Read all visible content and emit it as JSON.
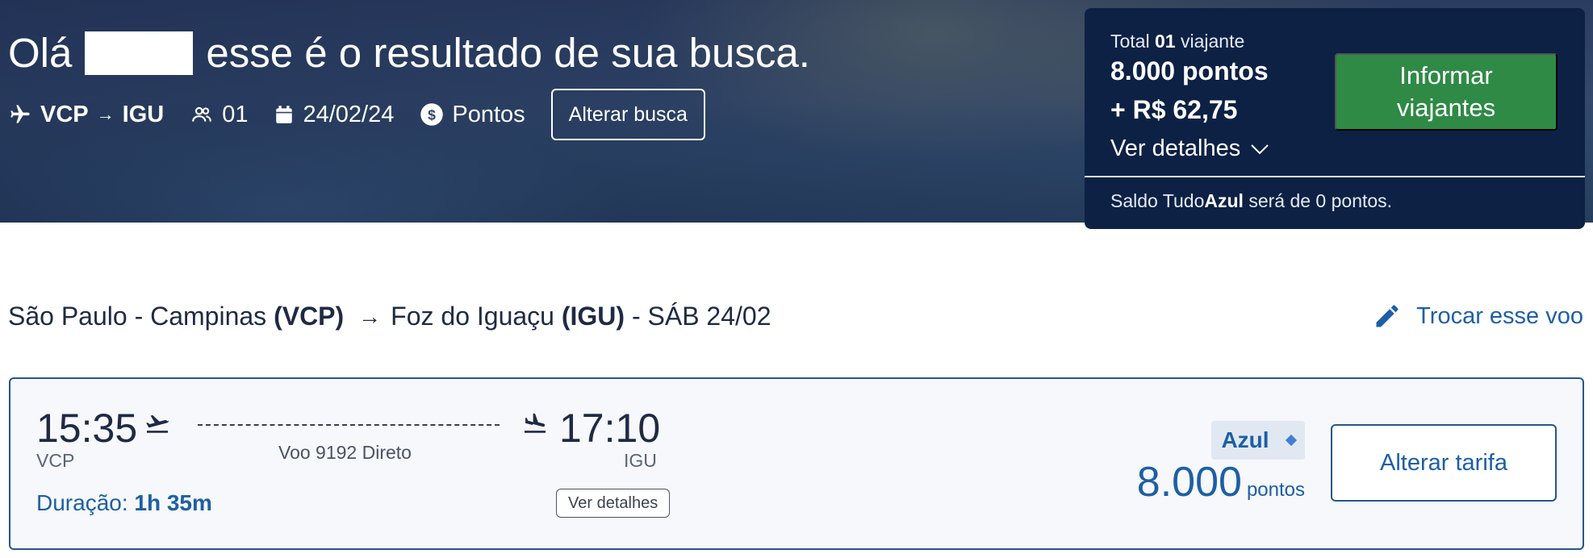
{
  "hero": {
    "greeting_prefix": "Olá",
    "greeting_suffix": "esse é o resultado de sua busca.",
    "origin": "VCP",
    "destination": "IGU",
    "passengers": "01",
    "date": "24/02/24",
    "payment_type": "Pontos",
    "alter_search_label": "Alterar busca"
  },
  "summary": {
    "total_label": "Total",
    "total_count": "01",
    "total_unit": "viajante",
    "points": "8.000 pontos",
    "cash": "+ R$ 62,75",
    "details_label": "Ver detalhes",
    "inform_button": "Informar viajantes",
    "saldo_prefix": "Saldo Tudo",
    "saldo_brand": "Azul",
    "saldo_suffix": "será de 0 pontos."
  },
  "route": {
    "origin_city": "São Paulo - Campinas",
    "origin_code": "(VCP)",
    "destination_city": "Foz do Iguaçu",
    "destination_code": "(IGU)",
    "date_text": "- SÁB 24/02",
    "swap_label": "Trocar esse voo"
  },
  "flight": {
    "departure_time": "15:35",
    "departure_code": "VCP",
    "arrival_time": "17:10",
    "arrival_code": "IGU",
    "info": "Voo 9192 Direto",
    "duration_label": "Duração:",
    "duration_value": "1h 35m",
    "details_button": "Ver detalhes",
    "fare_name": "Azul",
    "price": "8.000",
    "price_unit": "pontos",
    "change_fare_button": "Alterar tarifa"
  },
  "colors": {
    "brand_blue": "#1d5fa4",
    "panel_navy": "#0d2145",
    "cta_green": "#2f8a46"
  }
}
